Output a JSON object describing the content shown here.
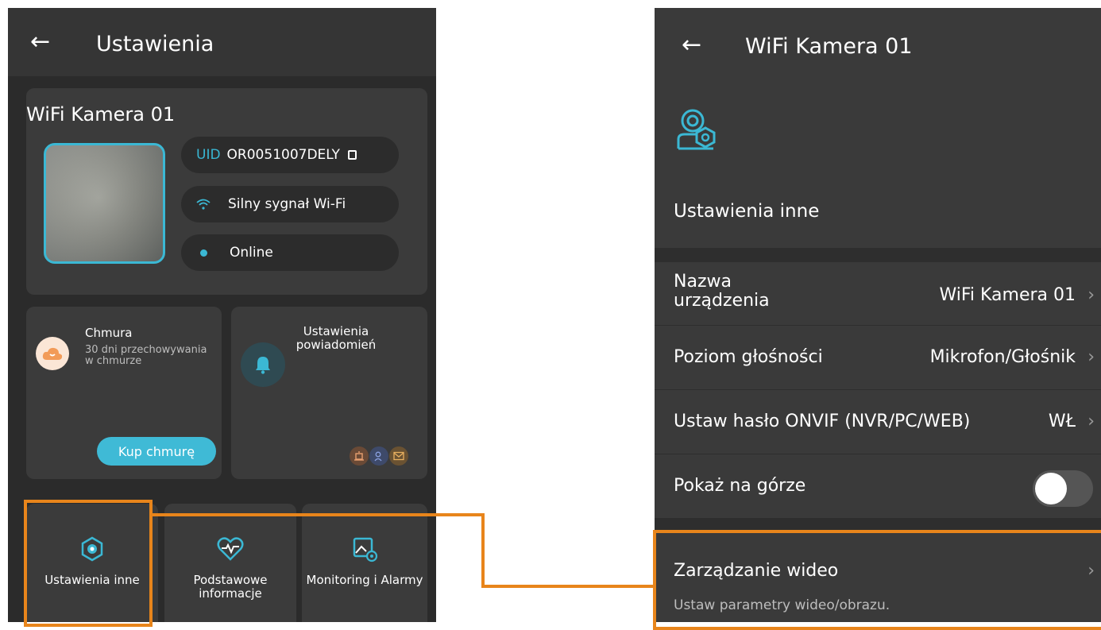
{
  "left_screen": {
    "title": "Ustawienia",
    "device": {
      "name": "WiFi Kamera 01",
      "uid_label": "UID",
      "uid_value": "OR0051007DELY",
      "wifi_status": "Silny sygnał Wi-Fi",
      "online_status": "Online"
    },
    "cloud": {
      "title": "Chmura",
      "description": "30 dni przechowywania w chmurze",
      "button": "Kup chmurę"
    },
    "notifications": {
      "title": "Ustawienia powiadomień"
    },
    "tiles": {
      "other": "Ustawienia inne",
      "basic": "Podstawowe informacje",
      "monitoring": "Monitoring i Alarmy"
    }
  },
  "right_screen": {
    "title": "WiFi Kamera 01",
    "section_title": "Ustawienia inne",
    "rows": {
      "name_label": "Nazwa urządzenia",
      "name_value": "WiFi Kamera 01",
      "volume_label": "Poziom głośności",
      "volume_value": "Mikrofon/Głośnik",
      "onvif_label": "Ustaw hasło ONVIF (NVR/PC/WEB)",
      "onvif_value": "WŁ",
      "top_label": "Pokaż na górze",
      "video_label": "Zarządzanie wideo",
      "video_desc": "Ustaw parametry wideo/obrazu."
    }
  },
  "colors": {
    "accent": "#3bb8d4",
    "highlight": "#e8851b",
    "background": "#2b2b2b",
    "card": "#3b3b3b"
  }
}
